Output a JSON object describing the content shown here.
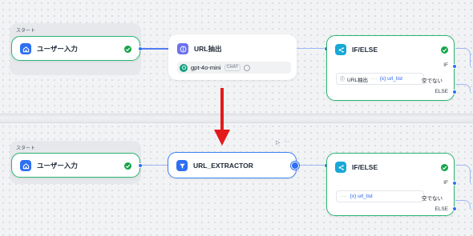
{
  "top": {
    "start_label": "スタート",
    "user_input": {
      "title": "ユーザー入力",
      "icon": "home-icon"
    },
    "url_node": {
      "title": "URL抽出",
      "model": "gpt-4o-mini",
      "chip": "CHAT",
      "icon": "info-icon"
    },
    "ifelse": {
      "title": "IF/ELSE",
      "if_label": "IF",
      "else_label": "ELSE",
      "cond_source": "URL抽出",
      "cond_sep": "····",
      "cond_var": "{x} url_list",
      "cond_op": "空でない"
    }
  },
  "bottom": {
    "start_label": "スタート",
    "user_input": {
      "title": "ユーザー入力",
      "icon": "home-icon"
    },
    "extractor": {
      "title": "URL_EXTRACTOR",
      "icon": "funnel-icon"
    },
    "toolbar": {
      "run": "▷",
      "more": "···"
    },
    "ifelse": {
      "title": "IF/ELSE",
      "if_label": "IF",
      "else_label": "ELSE",
      "cond_sep": "····",
      "cond_var": "{x} url_list",
      "cond_op": "空でない"
    }
  },
  "colors": {
    "accent": "#2e6ff2",
    "success": "#16a34a",
    "arrow": "#e31a1a",
    "selected_border": "#2bb673"
  }
}
